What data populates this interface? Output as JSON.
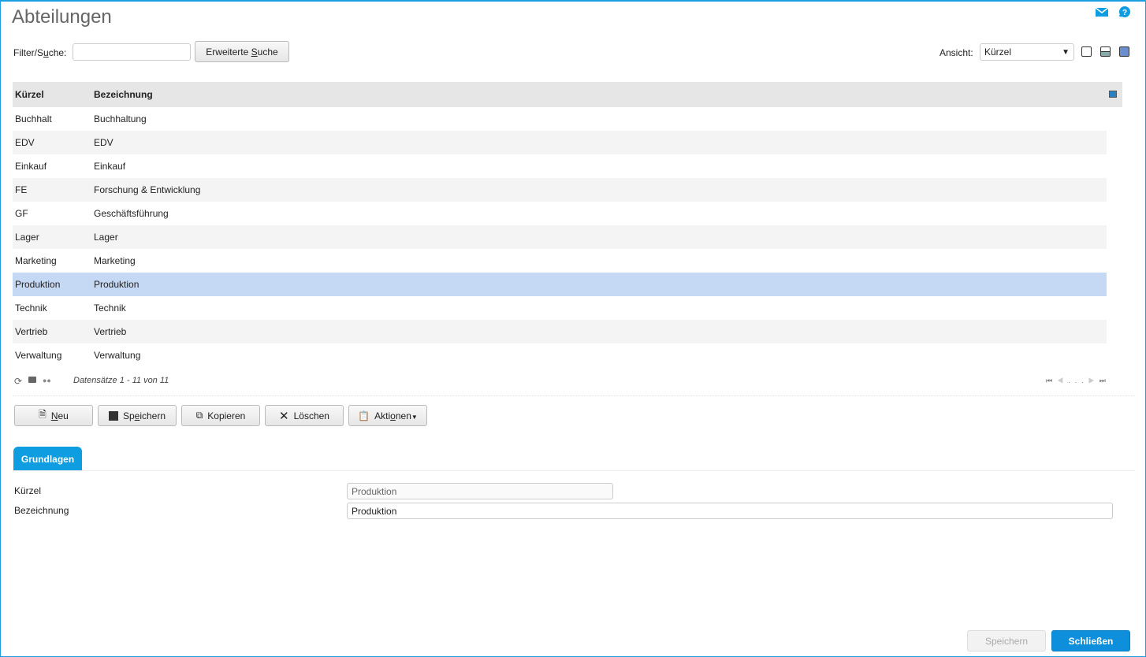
{
  "title": "Abteilungen",
  "filter": {
    "label_pre": "Filter/S",
    "label_u": "u",
    "label_post": "che:",
    "value": "",
    "adv_pre": "Erweiterte ",
    "adv_u": "S",
    "adv_post": "uche"
  },
  "view": {
    "label": "Ansicht:",
    "selected": "Kürzel"
  },
  "table": {
    "headers": [
      "Kürzel",
      "Bezeichnung"
    ],
    "rows": [
      [
        "Buchhalt",
        "Buchhaltung"
      ],
      [
        "EDV",
        "EDV"
      ],
      [
        "Einkauf",
        "Einkauf"
      ],
      [
        "FE",
        "Forschung & Entwicklung"
      ],
      [
        "GF",
        "Geschäftsführung"
      ],
      [
        "Lager",
        "Lager"
      ],
      [
        "Marketing",
        "Marketing"
      ],
      [
        "Produktion",
        "Produktion"
      ],
      [
        "Technik",
        "Technik"
      ],
      [
        "Vertrieb",
        "Vertrieb"
      ],
      [
        "Verwaltung",
        "Verwaltung"
      ]
    ],
    "selected_index": 7
  },
  "footer": {
    "records": "Datensätze 1 - 11 von 11",
    "ellipsis": "..."
  },
  "toolbar": {
    "new_u": "N",
    "new_post": "eu",
    "save_pre": "Sp",
    "save_u": "e",
    "save_post": "ichern",
    "copy": "Kopieren",
    "delete": "Löschen",
    "actions_pre": "Akti",
    "actions_u": "o",
    "actions_post": "nen"
  },
  "tab": "Grundlagen",
  "form": {
    "kuerzel_label": "Kürzel",
    "kuerzel_value": "Produktion",
    "bez_label": "Bezeichnung",
    "bez_value": "Produktion"
  },
  "bottom": {
    "save": "Speichern",
    "close": "Schließen"
  },
  "colors": {
    "accent": "#0d9de0",
    "selected": "#c5d9f5"
  }
}
